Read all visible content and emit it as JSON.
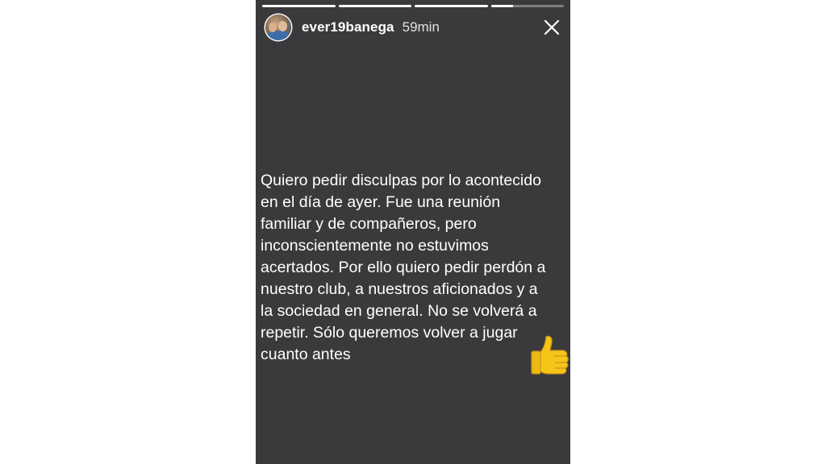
{
  "story": {
    "progress_segments": [
      1,
      1,
      1,
      0.3
    ],
    "user": {
      "username": "ever19banega",
      "time_ago": "59min"
    },
    "close_icon": "close-icon",
    "message": "Quiero pedir disculpas por lo acontecido\nen el día de ayer. Fue una reunión\nfamiliar y de compañeros, pero\ninconscientemente no estuvimos\nacertados. Por ello quiero pedir perdón a\nnuestro club, a nuestros aficionados y a\nla sociedad en general. No se volverá a\nrepetir. Sólo queremos volver a jugar\ncuanto antes",
    "emoji": "thumbs-up-icon",
    "colors": {
      "background": "#3a3a3c",
      "text": "#ffffff",
      "emoji": "#f5c518"
    }
  }
}
